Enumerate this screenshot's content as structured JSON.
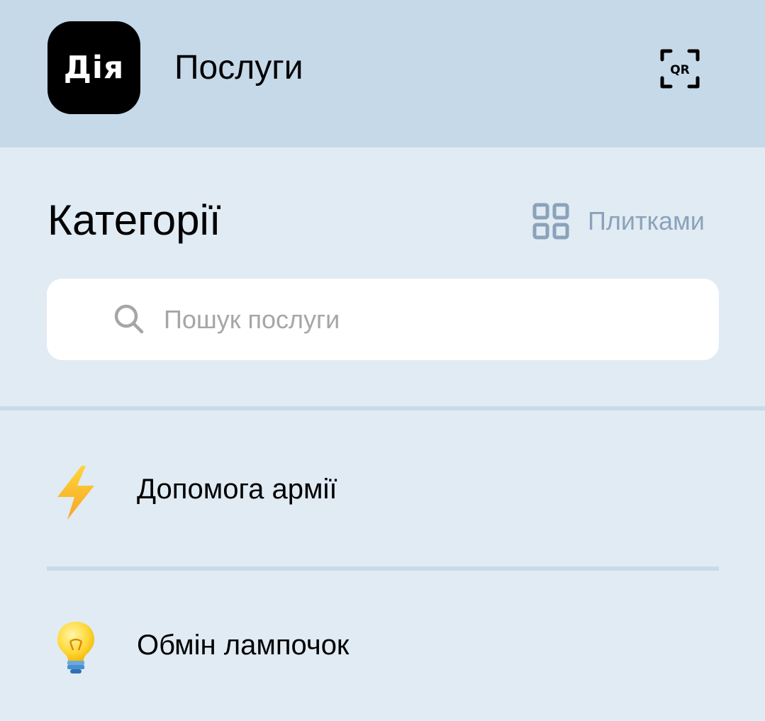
{
  "header": {
    "logo_text": "Дія",
    "title": "Послуги",
    "qr_icon": "qr-scan-icon",
    "qr_label": "QR"
  },
  "categories_section": {
    "title": "Категорії",
    "view_toggle_icon": "grid-icon",
    "view_toggle_label": "Плитками"
  },
  "search": {
    "placeholder": "Пошук послуги",
    "value": ""
  },
  "categories": [
    {
      "label": "Допомога армії",
      "icon": "lightning-icon"
    },
    {
      "label": "Обмін лампочок",
      "icon": "lightbulb-icon"
    }
  ],
  "colors": {
    "header_bg": "#c5d9e9",
    "page_bg": "#e1ebf4",
    "accent_muted": "#8aa3ba"
  }
}
